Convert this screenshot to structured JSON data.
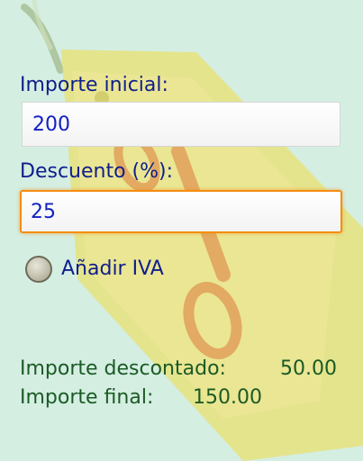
{
  "form": {
    "initial_amount": {
      "label": "Importe inicial:",
      "value": "200"
    },
    "discount": {
      "label": "Descuento (%):",
      "value": "25"
    },
    "vat_option": {
      "label": "Añadir IVA",
      "checked": false
    }
  },
  "results": {
    "discounted_label": "Importe descontado:",
    "discounted_value": "50.00",
    "final_label": "Importe final:",
    "final_value": "150.00"
  },
  "background": {
    "icon": "percent-tag-icon",
    "colors": {
      "base": "#d4eee2",
      "tag": "#e8e27a",
      "percent": "#df9450",
      "string": "#8ea56d"
    }
  },
  "colors": {
    "label": "#101e8a",
    "input_text": "#1321c2",
    "result_text": "#1b5a24",
    "focus": "#f48d14"
  }
}
